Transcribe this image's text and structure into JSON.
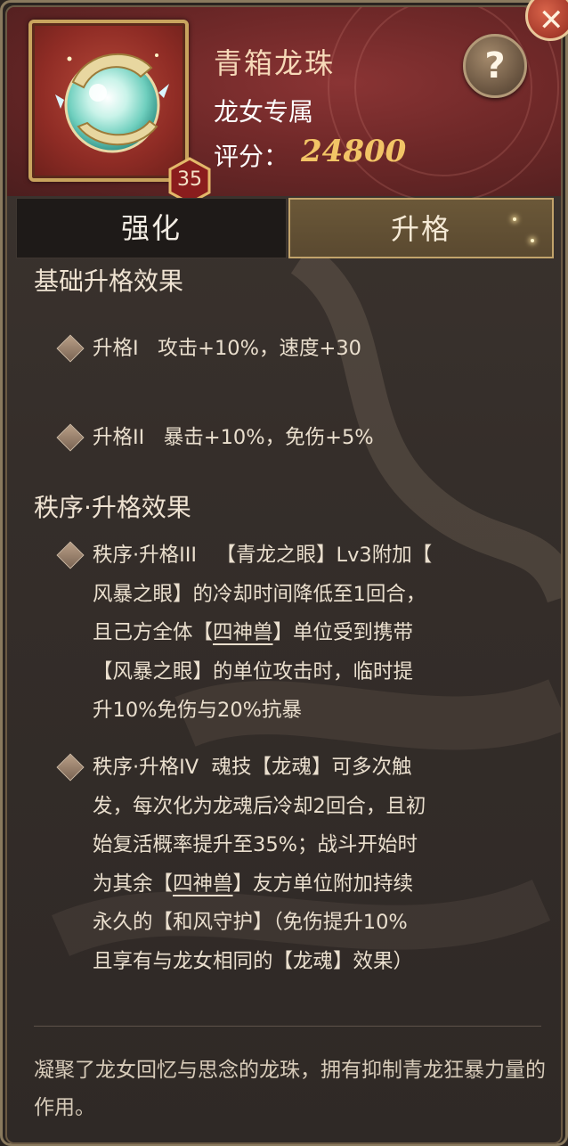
{
  "item": {
    "name": "青箱龙珠",
    "owner": "龙女专属",
    "score_label": "评分：",
    "score_value": "24800",
    "level": "35"
  },
  "buttons": {
    "help": "?",
    "close": "✕"
  },
  "tabs": [
    {
      "label": "强化",
      "active": false
    },
    {
      "label": "升格",
      "active": true
    }
  ],
  "basic_section": {
    "title": "基础升格效果",
    "entries": [
      {
        "tier": "升格I",
        "text": "攻击+10%，速度+30"
      },
      {
        "tier": "升格II",
        "text": "暴击+10%，免伤+5%"
      }
    ]
  },
  "order_section": {
    "title": "秩序·升格效果",
    "entries": [
      {
        "tier": "秩序·升格III",
        "lines": [
          [
            "【青龙之眼】Lv3附加【"
          ],
          [
            "风暴之眼】的冷却时间降低至1回合，"
          ],
          [
            "且己方全体【",
            "四神兽",
            "】单位受到携带"
          ],
          [
            "【风暴之眼】的单位攻击时，临时提"
          ],
          [
            "升10%免伤与20%抗暴"
          ]
        ]
      },
      {
        "tier": "秩序·升格IV",
        "lines": [
          [
            "魂技【龙魂】可多次触"
          ],
          [
            "发，每次化为龙魂后冷却2回合，且初"
          ],
          [
            "始复活概率提升至35%；战斗开始时"
          ],
          [
            "为其余【",
            "四神兽",
            "】友方单位附加持续"
          ],
          [
            "永久的【和风守护】（免伤提升10%"
          ],
          [
            "且享有与龙女相同的【龙魂】效果）"
          ]
        ]
      }
    ]
  },
  "description": "凝聚了龙女回忆与思念的龙珠，拥有抑制青龙狂暴力量的作用。",
  "colors": {
    "score": "#f2c466",
    "header_red": "#6e2828",
    "gold_border": "#c9a45e"
  }
}
